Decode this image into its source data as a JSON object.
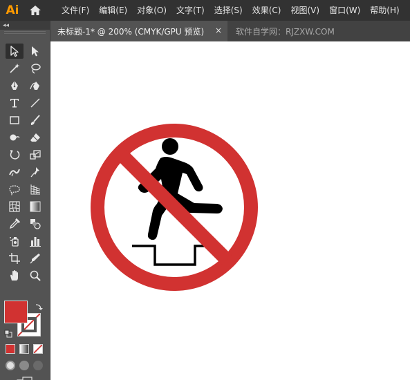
{
  "app": {
    "logo_text": "Ai",
    "brand_color": "#FF9A00"
  },
  "menu": {
    "items": [
      "文件(F)",
      "编辑(E)",
      "对象(O)",
      "文字(T)",
      "选择(S)",
      "效果(C)",
      "视图(V)",
      "窗口(W)",
      "帮助(H)"
    ]
  },
  "tabs": {
    "document_title": "未标题-1* @ 200% (CMYK/GPU 预览)",
    "close_glyph": "×",
    "watermark_text": "软件自学网：RJZXW.COM"
  },
  "toolbar": {
    "collapse_glyph": "◂◂",
    "tools": [
      "selection-tool",
      "direct-selection-tool",
      "magic-wand-tool",
      "lasso-tool",
      "pen-tool",
      "curvature-tool",
      "type-tool",
      "line-segment-tool",
      "rectangle-tool",
      "paintbrush-tool",
      "shaper-tool",
      "eraser-tool",
      "rotate-tool",
      "scale-tool",
      "width-tool",
      "puppet-warp-tool",
      "free-transform-tool",
      "perspective-grid-tool",
      "mesh-tool",
      "gradient-tool",
      "eyedropper-tool",
      "blend-tool",
      "symbol-sprayer-tool",
      "column-graph-tool",
      "artboard-tool",
      "slice-tool",
      "hand-tool",
      "zoom-tool"
    ]
  },
  "colors": {
    "fill": "#D13231",
    "stroke": "#FFFFFF",
    "canvas": "#FFFFFF",
    "sign_red": "#D13231",
    "figure": "#000000"
  },
  "artwork": {
    "description_name": "no-stepping-prohibition-sign"
  }
}
